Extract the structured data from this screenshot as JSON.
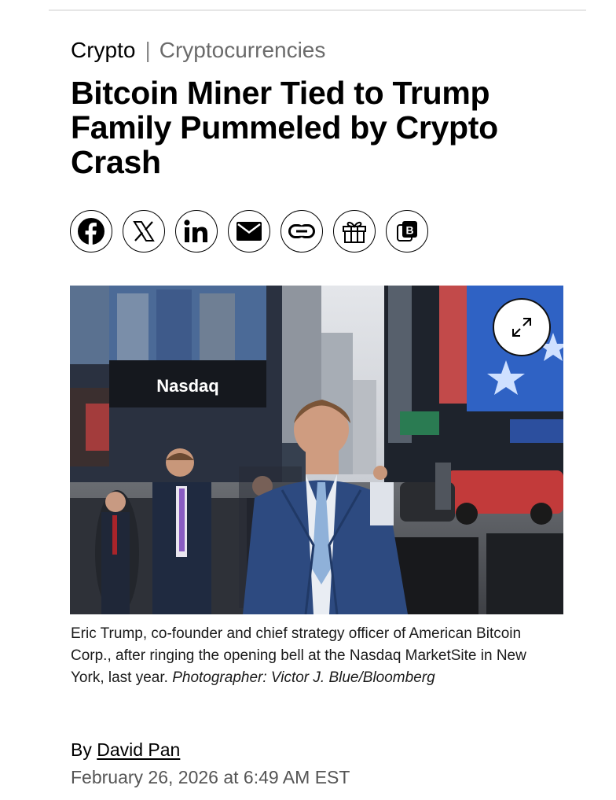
{
  "breadcrumb": {
    "primary": "Crypto",
    "separator": "|",
    "secondary": "Cryptocurrencies"
  },
  "headline": "Bitcoin Miner Tied to Trump Family Pummeled by Crypto Crash",
  "share_buttons": [
    {
      "icon": "facebook-icon"
    },
    {
      "icon": "x-icon"
    },
    {
      "icon": "linkedin-icon"
    },
    {
      "icon": "email-icon"
    },
    {
      "icon": "link-icon"
    },
    {
      "icon": "gift-icon"
    },
    {
      "icon": "bookmark-b-icon"
    }
  ],
  "photo": {
    "signage_text": "Nasdaq",
    "expand_icon": "expand-arrows-icon"
  },
  "caption": {
    "text": "Eric Trump, co-founder and chief strategy officer of American Bitcoin Corp., after ringing the opening bell at the Nasdaq MarketSite in New York, last year. ",
    "credit": "Photographer: Victor J. Blue/Bloomberg"
  },
  "byline": {
    "prefix": "By ",
    "author": "David Pan"
  },
  "date": "February 26, 2026 at 6:49 AM EST"
}
